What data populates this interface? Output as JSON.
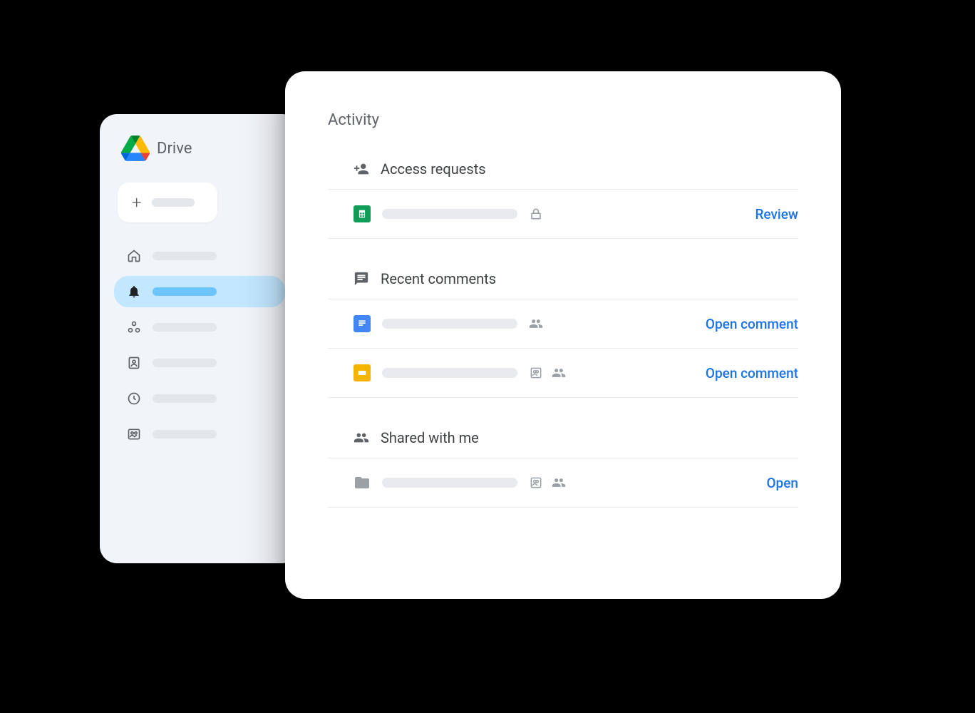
{
  "sidebar": {
    "title": "Drive"
  },
  "panel": {
    "title": "Activity",
    "sections": {
      "access": {
        "title": "Access requests",
        "rows": [
          {
            "action": "Review"
          }
        ]
      },
      "comments": {
        "title": "Recent comments",
        "rows": [
          {
            "action": "Open comment"
          },
          {
            "action": "Open comment"
          }
        ]
      },
      "shared": {
        "title": "Shared with me",
        "rows": [
          {
            "action": "Open"
          }
        ]
      }
    }
  }
}
